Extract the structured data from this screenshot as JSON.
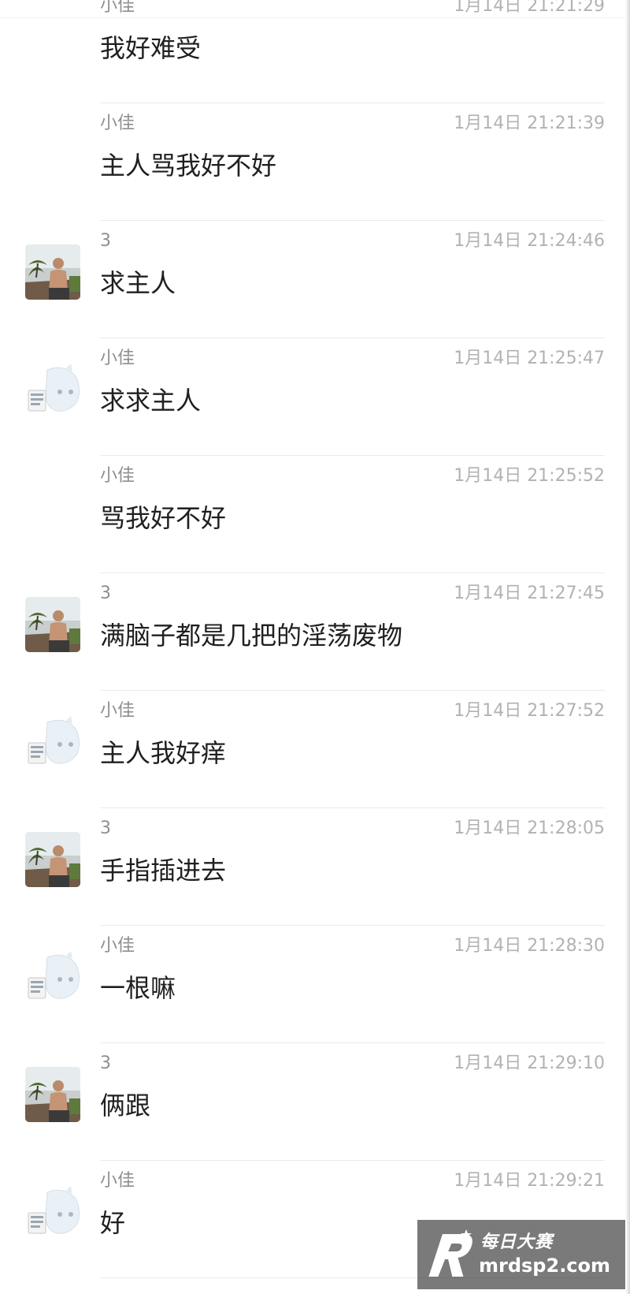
{
  "messages": [
    {
      "sender": "小佳",
      "time": "1月14日 21:21:29",
      "text": "我好难受",
      "avatar": "none"
    },
    {
      "sender": "小佳",
      "time": "1月14日 21:21:39",
      "text": "主人骂我好不好",
      "avatar": "none"
    },
    {
      "sender": "3",
      "time": "1月14日 21:24:46",
      "text": "求主人",
      "avatar": "photo-avatar"
    },
    {
      "sender": "小佳",
      "time": "1月14日 21:25:47",
      "text": "求求主人",
      "avatar": "cartoon-avatar"
    },
    {
      "sender": "小佳",
      "time": "1月14日 21:25:52",
      "text": "骂我好不好",
      "avatar": "none"
    },
    {
      "sender": "3",
      "time": "1月14日 21:27:45",
      "text": "满脑子都是几把的淫荡废物",
      "avatar": "photo-avatar"
    },
    {
      "sender": "小佳",
      "time": "1月14日 21:27:52",
      "text": "主人我好痒",
      "avatar": "cartoon-avatar"
    },
    {
      "sender": "3",
      "time": "1月14日 21:28:05",
      "text": "手指插进去",
      "avatar": "photo-avatar"
    },
    {
      "sender": "小佳",
      "time": "1月14日 21:28:30",
      "text": "一根嘛",
      "avatar": "cartoon-avatar"
    },
    {
      "sender": "3",
      "time": "1月14日 21:29:10",
      "text": "俩跟",
      "avatar": "photo-avatar"
    },
    {
      "sender": "小佳",
      "time": "1月14日 21:29:21",
      "text": "好",
      "avatar": "cartoon-avatar"
    }
  ],
  "watermark": {
    "cn": "每日大赛",
    "url": "mrdsp2.com"
  },
  "colors": {
    "sender": "#8f8f8f",
    "timestamp": "#b2b2b2",
    "message": "#1f1f1f",
    "divider": "#eaeaea"
  }
}
